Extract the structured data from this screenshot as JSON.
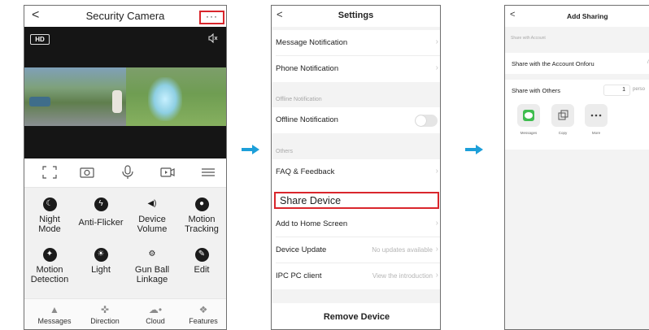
{
  "screen1": {
    "title": "Security Camera",
    "back": "<",
    "more": "···",
    "badge": "HD",
    "features": [
      {
        "label": "Night\nMode",
        "icon": "night-mode-icon"
      },
      {
        "label": "Anti-Flicker",
        "icon": "anti-flicker-icon"
      },
      {
        "label": "Device\nVolume",
        "icon": "volume-icon"
      },
      {
        "label": "Motion\nTracking",
        "icon": "motion-tracking-icon"
      },
      {
        "label": "Motion\nDetection",
        "icon": "motion-detection-icon"
      },
      {
        "label": "Light",
        "icon": "light-icon"
      },
      {
        "label": "Gun Ball\nLinkage",
        "icon": "gun-ball-linkage-icon"
      },
      {
        "label": "Edit",
        "icon": "edit-icon"
      }
    ],
    "tabs": [
      "Messages",
      "Direction",
      "Cloud",
      "Features"
    ]
  },
  "screen2": {
    "title": "Settings",
    "back": "<",
    "message_notification": "Message Notification",
    "phone_notification": "Phone Notification",
    "offline_section": "Offline Notification",
    "offline_notification": "Offline Notification",
    "others_section": "Others",
    "faq": "FAQ & Feedback",
    "share_device": "Share Device",
    "add_home": "Add to Home Screen",
    "device_update": "Device Update",
    "device_update_value": "No updates available",
    "ipc_client": "IPC PC client",
    "ipc_client_value": "View the introduction",
    "remove": "Remove Device"
  },
  "screen3": {
    "title": "Add Sharing",
    "back": "<",
    "section": "Share with Account",
    "share_account": "Share with the Account Onforu",
    "share_others": "Share with Others",
    "quantity": "1",
    "quantity_unit": "perso",
    "apps": [
      "Messages",
      "Copy",
      "More"
    ]
  },
  "colors": {
    "highlight": "#d9262c",
    "arrow": "#1d9fd9"
  }
}
